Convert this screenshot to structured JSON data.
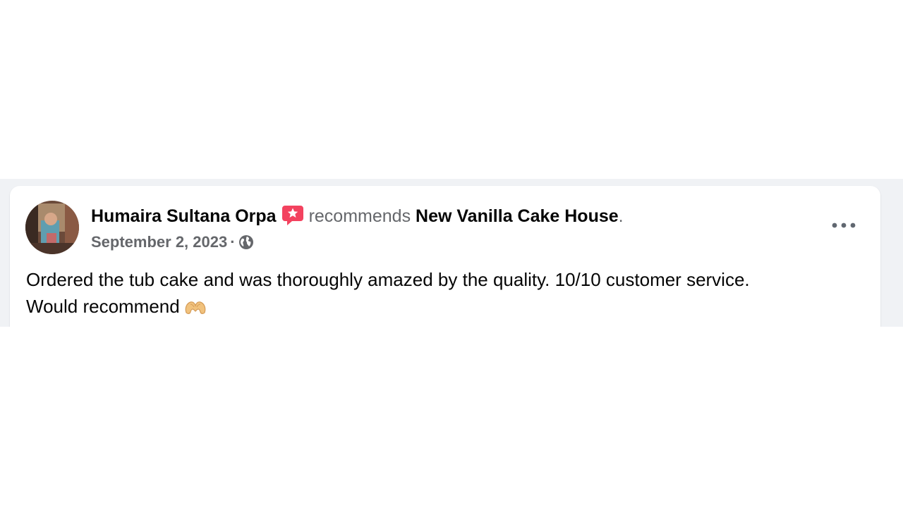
{
  "post": {
    "author_name": "Humaira Sultana Orpa",
    "action_text": "recommends",
    "page_name": "New Vanilla Cake House",
    "punctuation": ".",
    "date": "September 2, 2023",
    "separator": "·",
    "privacy_icon": "globe-icon",
    "recommend_icon": "recommend-star-icon",
    "more_icon": "more-options-icon",
    "body_line1": "Ordered the tub cake and was thoroughly amazed by the quality. 10/10 customer service.",
    "body_line2": "Would recommend",
    "emoji": "heart-hands-emoji"
  },
  "colors": {
    "background": "#f0f2f5",
    "card": "#ffffff",
    "primary_text": "#050505",
    "secondary_text": "#65676b",
    "recommend_badge": "#f3425f"
  }
}
